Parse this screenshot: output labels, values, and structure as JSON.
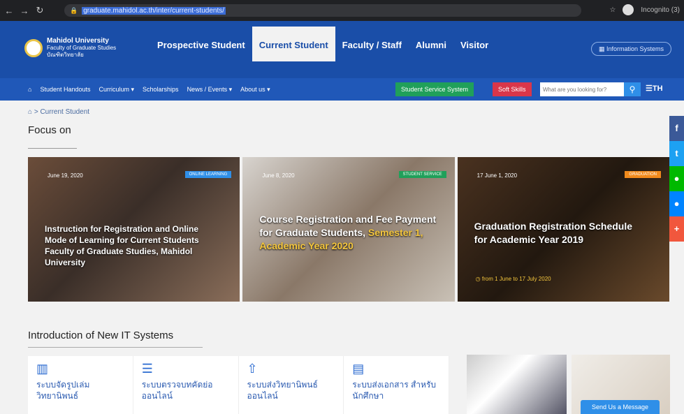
{
  "browser": {
    "url": "graduate.mahidol.ac.th/inter/current-students/",
    "profile": "Incognito (3)"
  },
  "header": {
    "logo_title": "Mahidol University",
    "logo_sub1": "Faculty of Graduate Studies",
    "logo_sub2": "บัณฑิตวิทยาลัย",
    "nav": [
      "Prospective Student",
      "Current Student",
      "Faculty / Staff",
      "Alumni",
      "Visitor"
    ],
    "info_systems": "Information Systems"
  },
  "subnav": {
    "links": [
      "Student Handouts",
      "Curriculum ▾",
      "Scholarships",
      "News / Events ▾",
      "About us ▾"
    ],
    "service": "Student Service System",
    "soft": "Soft Skills",
    "search_placeholder": "What are you looking for?",
    "lang": "TH"
  },
  "breadcrumb": "Current Student",
  "focus_title": "Focus on",
  "cards": [
    {
      "date": "June 19, 2020",
      "badge": "ONLINE LEARNING",
      "title": "Instruction for Registration and Online Mode of Learning for Current Students Faculty of Graduate Studies, Mahidol University",
      "badge_color": "#2f8fe8"
    },
    {
      "date": "June 8, 2020",
      "badge": "STUDENT SERVICE",
      "title_a": "Course Registration and Fee Payment for Graduate Students, ",
      "title_b": "Semester 1, Academic Year 2020",
      "badge_color": "#20a05a"
    },
    {
      "date": "17 June 1, 2020",
      "badge": "GRADUATION",
      "title": "Graduation Registration Schedule for Academic Year 2019",
      "meta": "◷ from 1 June to 17 July 2020",
      "badge_color": "#f08a1c"
    }
  ],
  "intro_title": "Introduction of New IT Systems",
  "it_systems": [
    {
      "icon": "▥",
      "label": "ระบบจัดรูปเล่ม วิทยานิพนธ์"
    },
    {
      "icon": "☰",
      "label": "ระบบตรวจบทคัดย่อ ออนไลน์"
    },
    {
      "icon": "⇧",
      "label": "ระบบส่งวิทยานิพนธ์ ออนไลน์"
    },
    {
      "icon": "▤",
      "label": "ระบบส่งเอกสาร สำหรับนักศึกษา"
    }
  ],
  "send_message": "Send Us a Message",
  "share_colors": [
    "#3b5998",
    "#1da1f2",
    "#00b900",
    "#0084ff",
    "#f1573d"
  ]
}
